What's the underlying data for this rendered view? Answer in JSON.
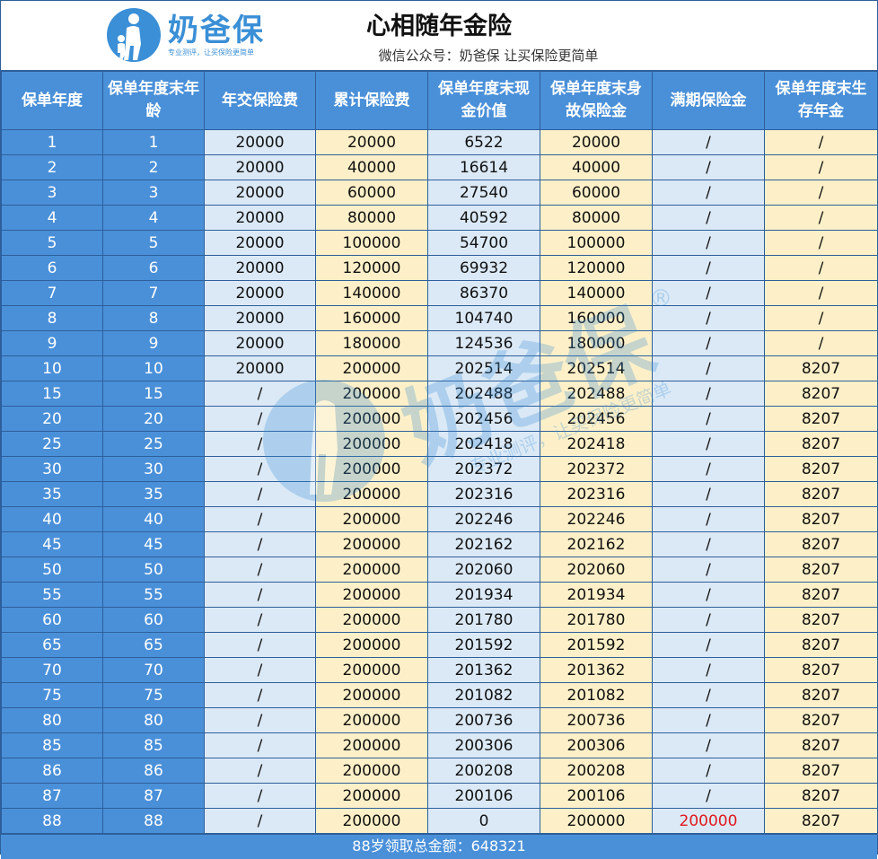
{
  "header": {
    "logo_name": "奶爸保",
    "logo_slogan": "专业测评，让买保险更简单",
    "title": "心相随年金险",
    "subtitle": "微信公众号：奶爸保   让买保险更简单"
  },
  "watermark": {
    "name": "奶爸保",
    "registered": "®",
    "slogan": "专业测评，让买保险更简单"
  },
  "colors": {
    "header_blue": "#4a90d9",
    "light_blue": "#dbe9f6",
    "light_yellow": "#fdf0c8",
    "highlight_red": "#e0191b",
    "logo_blue": "#3a8fd6"
  },
  "table": {
    "columns": [
      "保单年度",
      "保单年度末年龄",
      "年交保险费",
      "累计保险费",
      "保单年度末现金价值",
      "保单年度末身故保险金",
      "满期保险金",
      "保单年度末生存年金"
    ],
    "rows": [
      [
        "1",
        "1",
        "20000",
        "20000",
        "6522",
        "20000",
        "/",
        "/"
      ],
      [
        "2",
        "2",
        "20000",
        "40000",
        "16614",
        "40000",
        "/",
        "/"
      ],
      [
        "3",
        "3",
        "20000",
        "60000",
        "27540",
        "60000",
        "/",
        "/"
      ],
      [
        "4",
        "4",
        "20000",
        "80000",
        "40592",
        "80000",
        "/",
        "/"
      ],
      [
        "5",
        "5",
        "20000",
        "100000",
        "54700",
        "100000",
        "/",
        "/"
      ],
      [
        "6",
        "6",
        "20000",
        "120000",
        "69932",
        "120000",
        "/",
        "/"
      ],
      [
        "7",
        "7",
        "20000",
        "140000",
        "86370",
        "140000",
        "/",
        "/"
      ],
      [
        "8",
        "8",
        "20000",
        "160000",
        "104740",
        "160000",
        "/",
        "/"
      ],
      [
        "9",
        "9",
        "20000",
        "180000",
        "124536",
        "180000",
        "/",
        "/"
      ],
      [
        "10",
        "10",
        "20000",
        "200000",
        "202514",
        "202514",
        "/",
        "8207"
      ],
      [
        "15",
        "15",
        "/",
        "200000",
        "202488",
        "202488",
        "/",
        "8207"
      ],
      [
        "20",
        "20",
        "/",
        "200000",
        "202456",
        "202456",
        "/",
        "8207"
      ],
      [
        "25",
        "25",
        "/",
        "200000",
        "202418",
        "202418",
        "/",
        "8207"
      ],
      [
        "30",
        "30",
        "/",
        "200000",
        "202372",
        "202372",
        "/",
        "8207"
      ],
      [
        "35",
        "35",
        "/",
        "200000",
        "202316",
        "202316",
        "/",
        "8207"
      ],
      [
        "40",
        "40",
        "/",
        "200000",
        "202246",
        "202246",
        "/",
        "8207"
      ],
      [
        "45",
        "45",
        "/",
        "200000",
        "202162",
        "202162",
        "/",
        "8207"
      ],
      [
        "50",
        "50",
        "/",
        "200000",
        "202060",
        "202060",
        "/",
        "8207"
      ],
      [
        "55",
        "55",
        "/",
        "200000",
        "201934",
        "201934",
        "/",
        "8207"
      ],
      [
        "60",
        "60",
        "/",
        "200000",
        "201780",
        "201780",
        "/",
        "8207"
      ],
      [
        "65",
        "65",
        "/",
        "200000",
        "201592",
        "201592",
        "/",
        "8207"
      ],
      [
        "70",
        "70",
        "/",
        "200000",
        "201362",
        "201362",
        "/",
        "8207"
      ],
      [
        "75",
        "75",
        "/",
        "200000",
        "201082",
        "201082",
        "/",
        "8207"
      ],
      [
        "80",
        "80",
        "/",
        "200000",
        "200736",
        "200736",
        "/",
        "8207"
      ],
      [
        "85",
        "85",
        "/",
        "200000",
        "200306",
        "200306",
        "/",
        "8207"
      ],
      [
        "86",
        "86",
        "/",
        "200000",
        "200208",
        "200208",
        "/",
        "8207"
      ],
      [
        "87",
        "87",
        "/",
        "200000",
        "200106",
        "200106",
        "/",
        "8207"
      ],
      [
        "88",
        "88",
        "/",
        "200000",
        "0",
        "200000",
        "200000",
        "8207"
      ]
    ],
    "highlight": {
      "row": 27,
      "col": 6
    }
  },
  "footer": {
    "text": "88岁领取总金额：648321"
  }
}
